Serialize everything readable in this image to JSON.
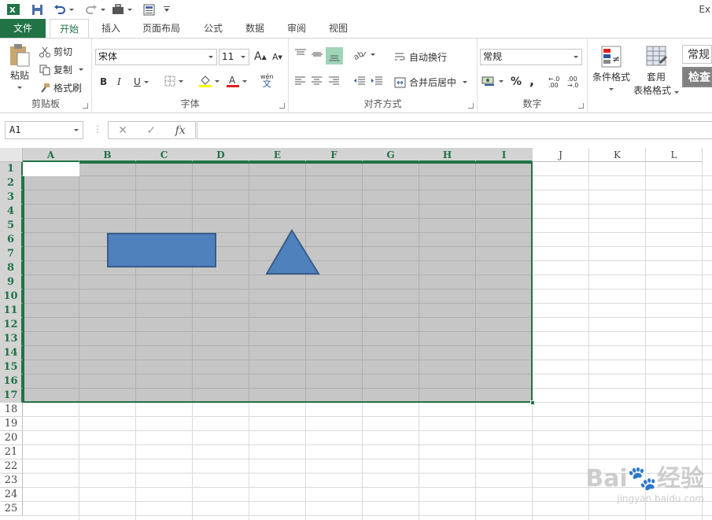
{
  "app_title": "Ex",
  "tabs": [
    {
      "label": "文件"
    },
    {
      "label": "开始"
    },
    {
      "label": "插入"
    },
    {
      "label": "页面布局"
    },
    {
      "label": "公式"
    },
    {
      "label": "数据"
    },
    {
      "label": "审阅"
    },
    {
      "label": "视图"
    }
  ],
  "ribbon": {
    "clipboard": {
      "label": "剪贴板",
      "paste": "粘贴",
      "cut": "剪切",
      "copy": "复制",
      "format_painter": "格式刷"
    },
    "font": {
      "label": "字体",
      "font_name": "宋体",
      "font_size": "11",
      "bold": "B",
      "italic": "I",
      "underline": "U",
      "grow": "A",
      "shrink": "A",
      "phonetic": "wén"
    },
    "alignment": {
      "label": "对齐方式",
      "wrap_text": "自动换行",
      "merge_center": "合并后居中"
    },
    "number": {
      "label": "数字",
      "format": "常规",
      "percent": "%",
      "comma": ",",
      "inc_decimal": "←.0 .00",
      "dec_decimal": ".00 →.0"
    },
    "styles": {
      "conditional": "条件格式",
      "table_format_1": "套用",
      "table_format_2": "表格格式",
      "style_normal": "常规",
      "style_check": "检查"
    }
  },
  "formula_bar": {
    "name_box": "A1",
    "cancel": "✕",
    "enter": "✓",
    "fx": "fx",
    "value": ""
  },
  "columns": [
    "A",
    "B",
    "C",
    "D",
    "E",
    "F",
    "G",
    "H",
    "I",
    "J",
    "K",
    "L"
  ],
  "rows": [
    "1",
    "2",
    "3",
    "4",
    "5",
    "6",
    "7",
    "8",
    "9",
    "10",
    "11",
    "12",
    "13",
    "14",
    "15",
    "16",
    "17",
    "18",
    "19",
    "20",
    "21",
    "22",
    "23",
    "24",
    "25"
  ],
  "selection": {
    "range": "A1:I17"
  },
  "shapes": {
    "fill": "#4f81bd",
    "stroke": "#385d8a"
  },
  "watermark": {
    "brand": "Bai",
    "brand2": "经验",
    "url": "jingyan.baidu.com"
  }
}
